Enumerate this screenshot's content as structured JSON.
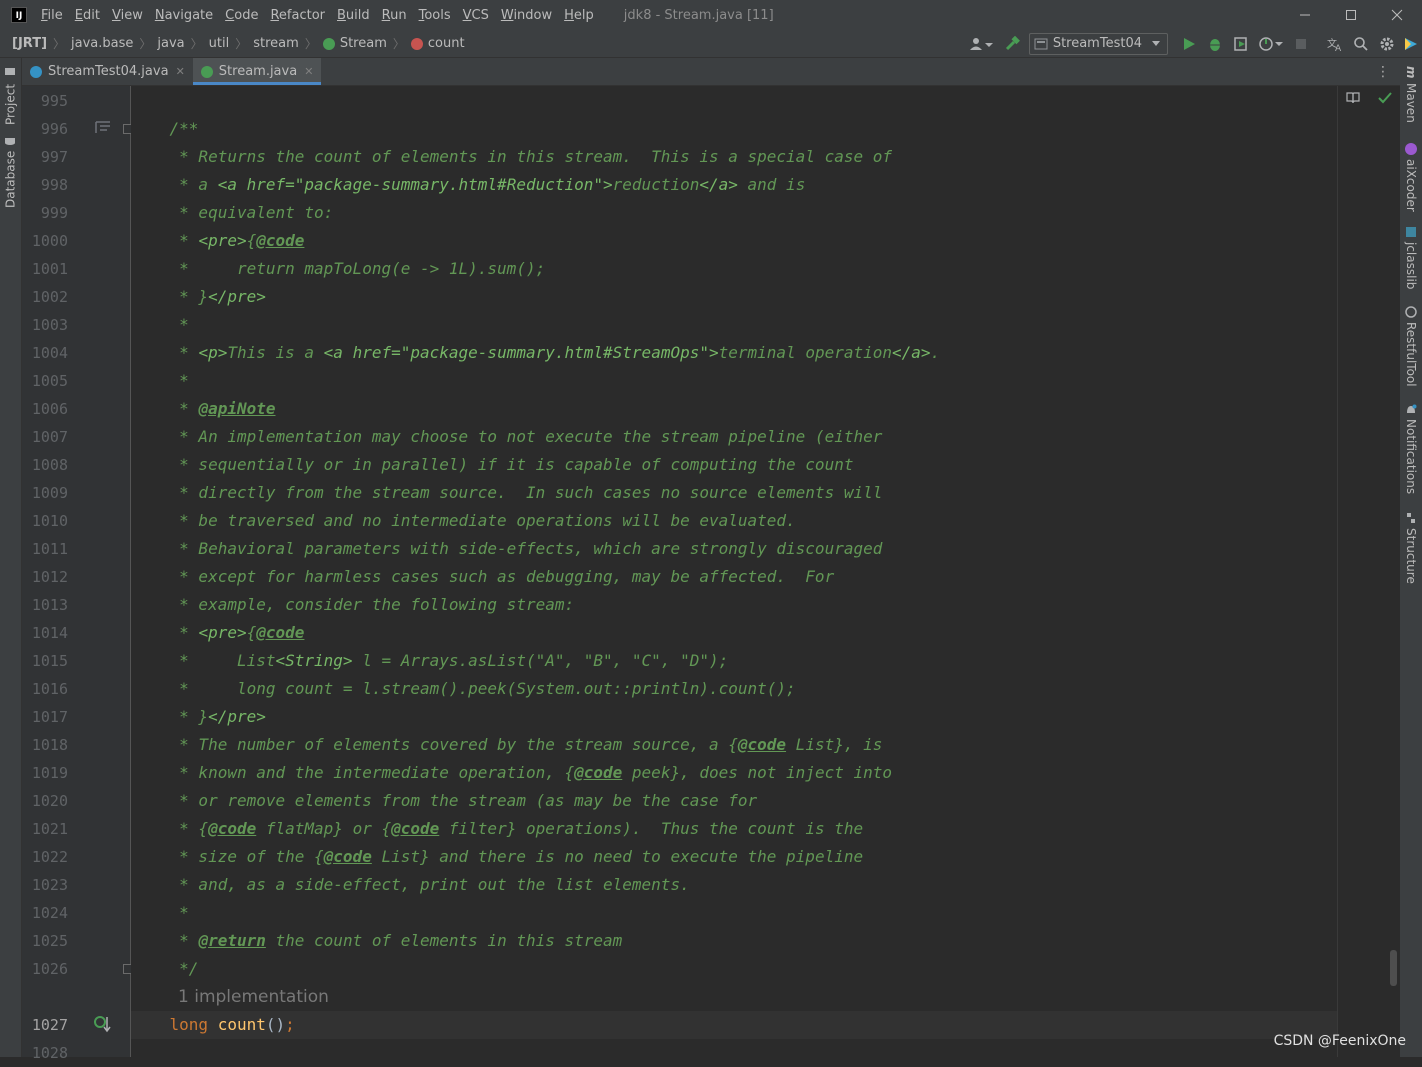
{
  "app": {
    "logo_text": "IJ",
    "menu": [
      "File",
      "Edit",
      "View",
      "Navigate",
      "Code",
      "Refactor",
      "Build",
      "Run",
      "Tools",
      "VCS",
      "Window",
      "Help"
    ],
    "window_title": "jdk8 - Stream.java [11]"
  },
  "navbar": {
    "breadcrumbs": [
      "[JRT]",
      "java.base",
      "java",
      "util",
      "stream",
      "Stream",
      "count"
    ],
    "run_config": "StreamTest04"
  },
  "left_tools": [
    "Project",
    "Database"
  ],
  "right_tools": [
    "Maven",
    "aiXcoder",
    "jclasslib",
    "RestfulTool",
    "Notifications",
    "Structure"
  ],
  "tabs": [
    {
      "label": "StreamTest04.java",
      "active": false
    },
    {
      "label": "Stream.java",
      "active": true
    }
  ],
  "editor": {
    "line_numbers": [
      "995",
      "996",
      "997",
      "998",
      "999",
      "1000",
      "1001",
      "1002",
      "1003",
      "1004",
      "1005",
      "1006",
      "1007",
      "1008",
      "1009",
      "1010",
      "1011",
      "1012",
      "1013",
      "1014",
      "1015",
      "1016",
      "1017",
      "1018",
      "1019",
      "1020",
      "1021",
      "1022",
      "1023",
      "1024",
      "1025",
      "1026",
      "",
      "1027",
      "1028"
    ],
    "code": [
      [],
      [
        [
          "doc",
          "    /**"
        ]
      ],
      [
        [
          "doc",
          "     * Returns the count of elements in this stream.  This is a special case of"
        ]
      ],
      [
        [
          "doc",
          "     * a "
        ],
        [
          "doc-html",
          "<a href=\"package-summary.html#Reduction\">"
        ],
        [
          "doc",
          "reduction"
        ],
        [
          "doc-html",
          "</a>"
        ],
        [
          "doc",
          " and is"
        ]
      ],
      [
        [
          "doc",
          "     * equivalent to:"
        ]
      ],
      [
        [
          "doc",
          "     * "
        ],
        [
          "doc-html",
          "<pre>"
        ],
        [
          "doc",
          "{"
        ],
        [
          "doc-tag",
          "@code"
        ]
      ],
      [
        [
          "doc",
          "     *     return mapToLong(e -> 1L).sum();"
        ]
      ],
      [
        [
          "doc",
          "     * }"
        ],
        [
          "doc-html",
          "</pre>"
        ]
      ],
      [
        [
          "doc",
          "     *"
        ]
      ],
      [
        [
          "doc",
          "     * "
        ],
        [
          "doc-html",
          "<p>"
        ],
        [
          "doc",
          "This is a "
        ],
        [
          "doc-html",
          "<a href=\"package-summary.html#StreamOps\">"
        ],
        [
          "doc",
          "terminal operation"
        ],
        [
          "doc-html",
          "</a>"
        ],
        [
          "doc",
          "."
        ]
      ],
      [
        [
          "doc",
          "     *"
        ]
      ],
      [
        [
          "doc",
          "     * "
        ],
        [
          "doc-tag",
          "@apiNote"
        ]
      ],
      [
        [
          "doc",
          "     * An implementation may choose to not execute the stream pipeline (either"
        ]
      ],
      [
        [
          "doc",
          "     * sequentially or in parallel) if it is capable of computing the count"
        ]
      ],
      [
        [
          "doc",
          "     * directly from the stream source.  In such cases no source elements will"
        ]
      ],
      [
        [
          "doc",
          "     * be traversed and no intermediate operations will be evaluated."
        ]
      ],
      [
        [
          "doc",
          "     * Behavioral parameters with side-effects, which are strongly discouraged"
        ]
      ],
      [
        [
          "doc",
          "     * except for harmless cases such as debugging, may be affected.  For"
        ]
      ],
      [
        [
          "doc",
          "     * example, consider the following stream:"
        ]
      ],
      [
        [
          "doc",
          "     * "
        ],
        [
          "doc-html",
          "<pre>"
        ],
        [
          "doc",
          "{"
        ],
        [
          "doc-tag",
          "@code"
        ]
      ],
      [
        [
          "doc",
          "     *     List"
        ],
        [
          "doc-html",
          "<String>"
        ],
        [
          "doc",
          " l = Arrays.asList(\"A\", \"B\", \"C\", \"D\");"
        ]
      ],
      [
        [
          "doc",
          "     *     long count = l.stream().peek(System.out::println).count();"
        ]
      ],
      [
        [
          "doc",
          "     * }"
        ],
        [
          "doc-html",
          "</pre>"
        ]
      ],
      [
        [
          "doc",
          "     * The number of elements covered by the stream source, a {"
        ],
        [
          "doc-tag",
          "@code"
        ],
        [
          "doc",
          " List}, is"
        ]
      ],
      [
        [
          "doc",
          "     * known and the intermediate operation, {"
        ],
        [
          "doc-tag",
          "@code"
        ],
        [
          "doc",
          " peek}, does not inject into"
        ]
      ],
      [
        [
          "doc",
          "     * or remove elements from the stream (as may be the case for"
        ]
      ],
      [
        [
          "doc",
          "     * {"
        ],
        [
          "doc-tag",
          "@code"
        ],
        [
          "doc",
          " flatMap} or {"
        ],
        [
          "doc-tag",
          "@code"
        ],
        [
          "doc",
          " filter} operations).  Thus the count is the"
        ]
      ],
      [
        [
          "doc",
          "     * size of the {"
        ],
        [
          "doc-tag",
          "@code"
        ],
        [
          "doc",
          " List} and there is no need to execute the pipeline"
        ]
      ],
      [
        [
          "doc",
          "     * and, as a side-effect, print out the list elements."
        ]
      ],
      [
        [
          "doc",
          "     *"
        ]
      ],
      [
        [
          "doc",
          "     * "
        ],
        [
          "doc-tag",
          "@return"
        ],
        [
          "doc",
          " the count of elements in this stream"
        ]
      ],
      [
        [
          "doc",
          "     */"
        ]
      ],
      [],
      [
        [
          "kw",
          "    long "
        ],
        [
          "fn",
          "count"
        ],
        [
          "plain",
          "()"
        ],
        [
          "punc",
          ";"
        ]
      ],
      []
    ],
    "implementations_hint": "1 implementation"
  },
  "watermark": "CSDN @FeenixOne",
  "colors": {
    "accent": "#4a88c7",
    "doc_comment": "#629755",
    "keyword": "#cc7832",
    "method": "#ffc66d",
    "run_green": "#499c54"
  }
}
